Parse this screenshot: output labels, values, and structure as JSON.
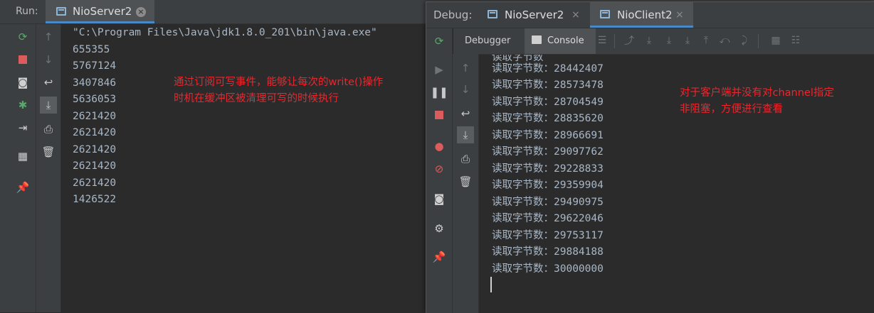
{
  "run": {
    "label": "Run:",
    "tab_title": "NioServer2",
    "command": "\"C:\\Program Files\\Java\\jdk1.8.0_201\\bin\\java.exe\"",
    "output": [
      "655355",
      "5767124",
      "3407846",
      "5636053",
      "2621420",
      "2621420",
      "2621420",
      "2621420",
      "2621420",
      "1426522"
    ],
    "annotation": [
      "通过订阅可写事件，能够让每次的write()操作",
      "时机在缓冲区被清理可写的时候执行"
    ]
  },
  "debug": {
    "label": "Debug:",
    "tabs": [
      "NioServer2",
      "NioClient2"
    ],
    "toolbar": {
      "debugger_label": "Debugger",
      "console_label": "Console"
    },
    "output": [
      "读取字节数：28442407",
      "读取字节数：28573478",
      "读取字节数：28704549",
      "读取字节数：28835620",
      "读取字节数：28966691",
      "读取字节数：29097762",
      "读取字节数：29228833",
      "读取字节数：29359904",
      "读取字节数：29490975",
      "读取字节数：29622046",
      "读取字节数：29753117",
      "读取字节数：29884188",
      "读取字节数：30000000"
    ],
    "partial_top_line": "读取字节数",
    "annotation": [
      "对于客户端并没有对channel指定",
      "非阻塞，方便进行查看"
    ]
  },
  "colors": {
    "annotation": "#e8282f",
    "accent": "#4a88c7"
  },
  "icons": [
    "rerun-icon",
    "stop-icon",
    "camera-icon",
    "debug-rerun-icon",
    "login-icon",
    "layout-icon",
    "pin-icon",
    "up-arrow-icon",
    "down-arrow-icon",
    "soft-wrap-icon",
    "scroll-end-icon",
    "print-icon",
    "trash-icon",
    "resume-icon",
    "pause-icon",
    "breakpoints-icon",
    "mute-icon",
    "settings-icon"
  ]
}
